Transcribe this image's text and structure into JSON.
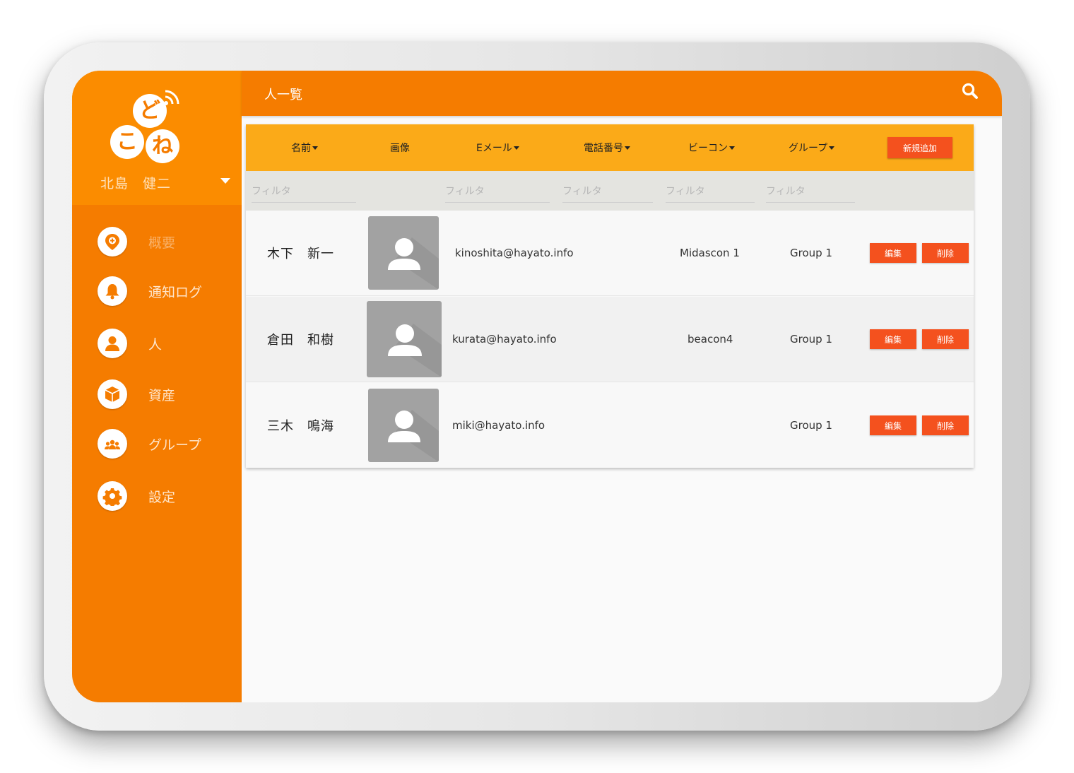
{
  "app": {
    "logo_chars": [
      "ど",
      "こ",
      "ね"
    ],
    "user_name": "北島　健二"
  },
  "nav": [
    {
      "label": "概要",
      "icon": "map-pin-icon",
      "muted": true
    },
    {
      "label": "通知ログ",
      "icon": "bell-icon",
      "muted": false
    },
    {
      "label": "人",
      "icon": "person-icon",
      "muted": false
    },
    {
      "label": "資産",
      "icon": "box-icon",
      "muted": false
    },
    {
      "label": "グループ",
      "icon": "group-icon",
      "muted": false
    },
    {
      "label": "設定",
      "icon": "gear-icon",
      "muted": false
    }
  ],
  "header": {
    "title": "人一覧",
    "search_icon": "search-icon"
  },
  "table": {
    "columns": [
      "名前",
      "画像",
      "Eメール",
      "電話番号",
      "ビーコン",
      "グループ"
    ],
    "add_label": "新規追加",
    "filter_placeholder": "フィルタ",
    "rows": [
      {
        "name": "木下　新一",
        "email": "kinoshita@hayato.info",
        "phone": "",
        "beacon": "Midascon 1",
        "group": "Group 1"
      },
      {
        "name": "倉田　和樹",
        "email": "kurata@hayato.info",
        "phone": "",
        "beacon": "beacon4",
        "group": "Group 1"
      },
      {
        "name": "三木　鳴海",
        "email": "miki@hayato.info",
        "phone": "",
        "beacon": "",
        "group": "Group 1"
      }
    ],
    "edit_label": "編集",
    "delete_label": "削除"
  },
  "colors": {
    "primary": "#f57c00",
    "header_accent": "#fbaa18",
    "action": "#f4511e"
  }
}
